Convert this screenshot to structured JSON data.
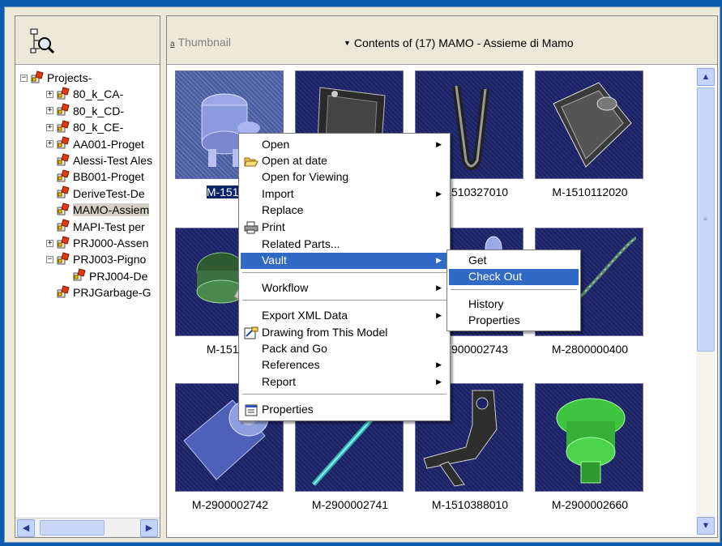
{
  "tree": {
    "root_label": "Projects-",
    "items": [
      {
        "label": "80_k_CA-",
        "expander": "+",
        "indent": 1
      },
      {
        "label": "80_k_CD-",
        "expander": "+",
        "indent": 1
      },
      {
        "label": "80_k_CE-",
        "expander": "+",
        "indent": 1
      },
      {
        "label": "AA001-Proget",
        "expander": "+",
        "indent": 1
      },
      {
        "label": "Alessi-Test Ales",
        "expander": "",
        "indent": 1
      },
      {
        "label": "BB001-Proget",
        "expander": "",
        "indent": 1
      },
      {
        "label": "DeriveTest-De",
        "expander": "",
        "indent": 1
      },
      {
        "label": "MAMO-Assiem",
        "expander": "",
        "indent": 1,
        "selected": true
      },
      {
        "label": "MAPI-Test per",
        "expander": "",
        "indent": 1
      },
      {
        "label": "PRJ000-Assen",
        "expander": "+",
        "indent": 1
      },
      {
        "label": "PRJ003-Pigno",
        "expander": "−",
        "indent": 1
      },
      {
        "label": "PRJ004-De",
        "expander": "",
        "indent": 2
      },
      {
        "label": "PRJGarbage-G",
        "expander": "",
        "indent": 1
      }
    ]
  },
  "header": {
    "thumbnail_label": "Thumbnail",
    "thumbnail_mini": "a",
    "contents_label": "Contents of (17) MAMO - Assieme di Mamo"
  },
  "thumbnails": [
    {
      "caption": "M-15104l",
      "shape": "cylinder-part",
      "selected": true
    },
    {
      "caption": "",
      "shape": "tray"
    },
    {
      "caption": "M-1510327010",
      "shape": "u-rod"
    },
    {
      "caption": "M-1510112020",
      "shape": "cover"
    },
    {
      "caption": "M-15104l",
      "shape": "green-sensor"
    },
    {
      "caption": "",
      "shape": "blank"
    },
    {
      "caption": "M-2900002743",
      "shape": "small-part"
    },
    {
      "caption": "M-2800000400",
      "shape": "wire"
    },
    {
      "caption": "M-2900002742",
      "shape": "blue-cylinder"
    },
    {
      "caption": "M-2900002741",
      "shape": "cyan-rod"
    },
    {
      "caption": "M-1510388010",
      "shape": "bracket"
    },
    {
      "caption": "M-2900002660",
      "shape": "green-knob"
    }
  ],
  "context_menu": {
    "items": [
      {
        "label": "Open",
        "submenu": true
      },
      {
        "label": "Open at date",
        "icon": "folder-open-icon"
      },
      {
        "label": "Open for Viewing"
      },
      {
        "label": "Import",
        "submenu": true
      },
      {
        "label": "Replace"
      },
      {
        "label": "Print",
        "icon": "printer-icon"
      },
      {
        "label": "Related Parts..."
      },
      {
        "label": "Vault",
        "submenu": true,
        "highlighted": true
      },
      {
        "label": "Workflow",
        "submenu": true
      },
      {
        "label": "Export XML Data",
        "submenu": true
      },
      {
        "label": "Drawing from This Model",
        "icon": "drawing-icon"
      },
      {
        "label": "Pack and Go"
      },
      {
        "label": "References",
        "submenu": true
      },
      {
        "label": "Report",
        "submenu": true
      },
      {
        "label": "Properties",
        "icon": "properties-icon"
      }
    ]
  },
  "vault_submenu": {
    "items": [
      {
        "label": "Get"
      },
      {
        "label": "Check Out",
        "highlighted": true
      },
      {
        "label": "History"
      },
      {
        "label": "Properties"
      }
    ]
  },
  "colors": {
    "selection": "#0a246a",
    "menu_highlight": "#316ac5",
    "thumb_bg": "#1c2266",
    "frame": "#0c5bb0"
  }
}
